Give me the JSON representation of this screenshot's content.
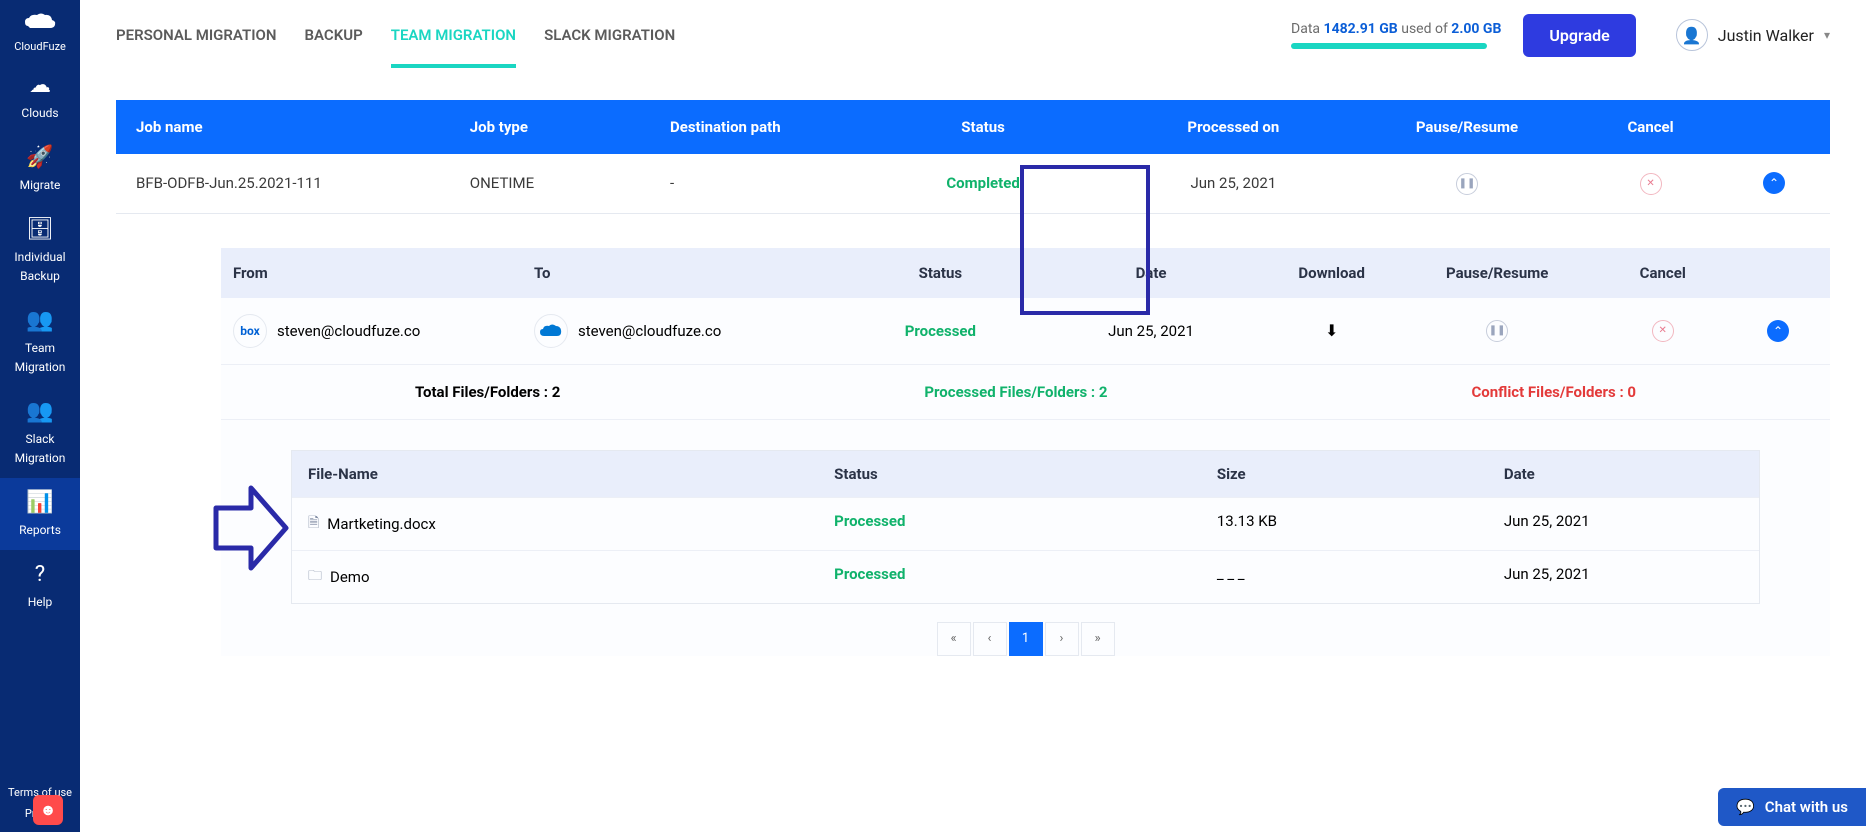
{
  "brand": "CloudFuze",
  "sidebar": {
    "items": [
      {
        "label": "Clouds"
      },
      {
        "label": "Migrate"
      },
      {
        "label": "Individual\nBackup"
      },
      {
        "label": "Team\nMigration"
      },
      {
        "label": "Slack\nMigration"
      },
      {
        "label": "Reports"
      },
      {
        "label": "Help"
      }
    ],
    "terms": "Terms of use",
    "privacy": "Privac"
  },
  "tabs": [
    {
      "label": "PERSONAL MIGRATION"
    },
    {
      "label": "BACKUP"
    },
    {
      "label": "TEAM MIGRATION"
    },
    {
      "label": "SLACK MIGRATION"
    }
  ],
  "usage": {
    "prefix": "Data ",
    "used": "1482.91 GB",
    "middle": " used of ",
    "total": "2.00 GB"
  },
  "upgrade": "Upgrade",
  "user": {
    "name": "Justin Walker"
  },
  "job": {
    "headers": [
      "Job name",
      "Job type",
      "Destination path",
      "Status",
      "Processed on",
      "Pause/Resume",
      "Cancel"
    ],
    "row": {
      "name": "BFB-ODFB-Jun.25.2021-111",
      "type": "ONETIME",
      "dest": "-",
      "status": "Completed",
      "processed_on": "Jun 25, 2021"
    }
  },
  "detail": {
    "headers": [
      "From",
      "To",
      "Status",
      "Date",
      "Download",
      "Pause/Resume",
      "Cancel"
    ],
    "row": {
      "from_email": "steven@cloudfuze.co",
      "to_email": "steven@cloudfuze.co",
      "status": "Processed",
      "date": "Jun 25, 2021"
    },
    "summary": {
      "total": "Total Files/Folders : 2",
      "processed": "Processed Files/Folders : 2",
      "conflict": "Conflict Files/Folders : 0"
    }
  },
  "files": {
    "headers": [
      "File-Name",
      "Status",
      "Size",
      "Date"
    ],
    "rows": [
      {
        "name": "Martketing.docx",
        "status": "Processed",
        "size": "13.13 KB",
        "date": "Jun 25, 2021",
        "kind": "file"
      },
      {
        "name": "Demo",
        "status": "Processed",
        "size": "_ _ _",
        "date": "Jun 25, 2021",
        "kind": "folder"
      }
    ]
  },
  "pager": {
    "current": "1"
  },
  "chat": "Chat with us",
  "icons": {
    "box": "box",
    "onedrive": "▲"
  }
}
